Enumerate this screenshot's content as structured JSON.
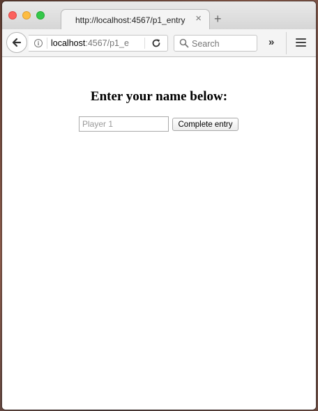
{
  "browser": {
    "tab_title": "http://localhost:4567/p1_entry",
    "tab_close": "×",
    "new_tab": "+",
    "url_host": "localhost",
    "url_path": ":4567/p1_e",
    "search_placeholder": "Search",
    "overflow": "»"
  },
  "page": {
    "heading": "Enter your name below:",
    "input_placeholder": "Player 1",
    "submit_label": "Complete entry"
  },
  "colors": {
    "close": "#fc615d",
    "minimize": "#fdbc40",
    "maximize": "#34c84a"
  }
}
